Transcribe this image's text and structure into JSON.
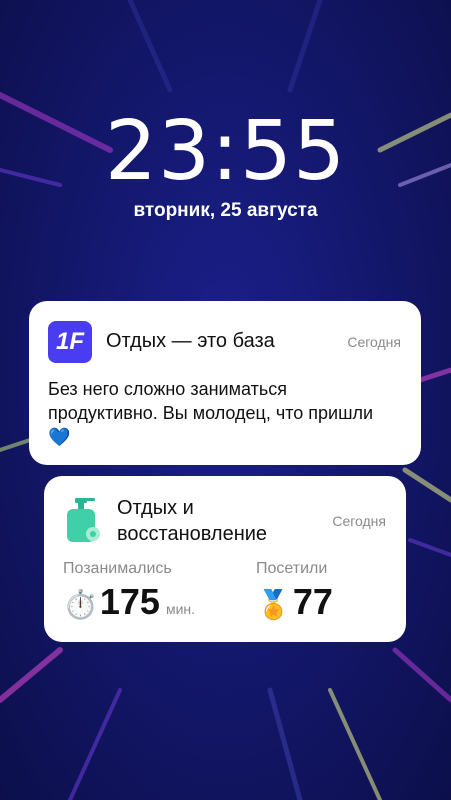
{
  "lockscreen": {
    "time": "23:55",
    "date": "вторник, 25 августа"
  },
  "notifications": [
    {
      "app_icon": "1F",
      "title": "Отдых — это база",
      "time": "Сегодня",
      "body": "Без него сложно заниматься продуктивно. Вы молодец, что пришли",
      "body_emoji": "💙"
    },
    {
      "icon": "sanitizer-bottle-icon",
      "title": "Отдых и восстановление",
      "time": "Сегодня",
      "stats": [
        {
          "label": "Позанимались",
          "icon": "⏱️",
          "value": "175",
          "unit": "мин."
        },
        {
          "label": "Посетили",
          "icon": "🏅",
          "value": "77",
          "unit": ""
        }
      ]
    }
  ],
  "colors": {
    "wallpaper": "#14186e",
    "app_icon": "#4a3cf0",
    "bottle": "#3fd0a8"
  }
}
